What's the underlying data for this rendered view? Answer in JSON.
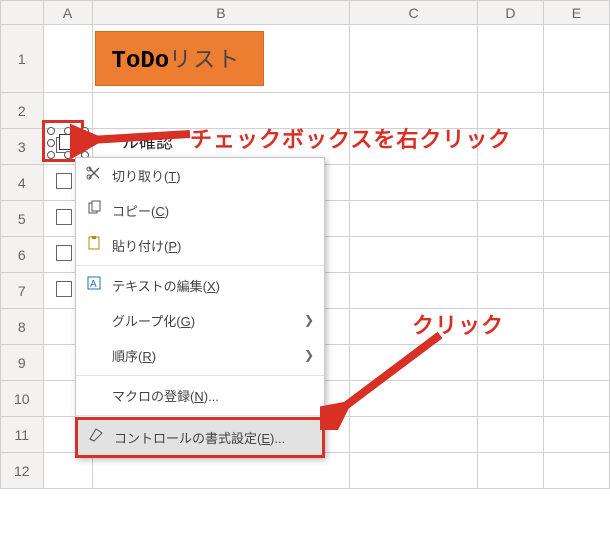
{
  "columns": [
    "A",
    "B",
    "C",
    "D",
    "E"
  ],
  "rows": [
    "1",
    "2",
    "3",
    "4",
    "5",
    "6",
    "7",
    "8",
    "9",
    "10",
    "11",
    "12"
  ],
  "title": {
    "bold": "ToDo",
    "rest": "リスト"
  },
  "visible_task_fragment": "ル確認",
  "context_menu": {
    "heading_fragment": "ル確認",
    "cut": {
      "label_pre": "切り取り(",
      "hot": "T",
      "label_post": ")"
    },
    "copy": {
      "label_pre": "コピー(",
      "hot": "C",
      "label_post": ")"
    },
    "paste": {
      "label_pre": "貼り付け(",
      "hot": "P",
      "label_post": ")"
    },
    "edit": {
      "label_pre": "テキストの編集(",
      "hot": "X",
      "label_post": ")"
    },
    "group": {
      "label_pre": "グループ化(",
      "hot": "G",
      "label_post": ")"
    },
    "order": {
      "label_pre": "順序(",
      "hot": "R",
      "label_post": ")"
    },
    "macro": {
      "label_pre": "マクロの登録(",
      "hot": "N",
      "label_post": ")..."
    },
    "format": {
      "label_pre": "コントロールの書式設定(",
      "hot": "E",
      "label_post": ")..."
    }
  },
  "annotations": {
    "rightclick": "チェックボックスを右クリック",
    "click": "クリック"
  }
}
